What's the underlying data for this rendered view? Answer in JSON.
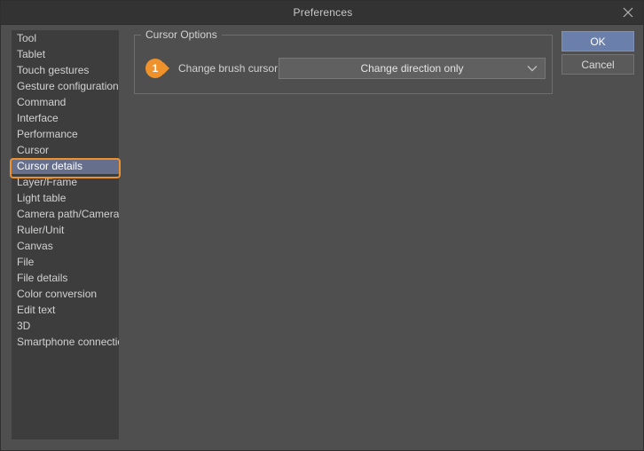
{
  "window": {
    "title": "Preferences",
    "close_icon": "close-icon"
  },
  "sidebar": {
    "items": [
      {
        "label": "Tool",
        "selected": false
      },
      {
        "label": "Tablet",
        "selected": false
      },
      {
        "label": "Touch gestures",
        "selected": false
      },
      {
        "label": "Gesture configuration",
        "selected": false
      },
      {
        "label": "Command",
        "selected": false
      },
      {
        "label": "Interface",
        "selected": false
      },
      {
        "label": "Performance",
        "selected": false
      },
      {
        "label": "Cursor",
        "selected": false
      },
      {
        "label": "Cursor details",
        "selected": true
      },
      {
        "label": "Layer/Frame",
        "selected": false
      },
      {
        "label": "Light table",
        "selected": false
      },
      {
        "label": "Camera path/Camera",
        "selected": false
      },
      {
        "label": "Ruler/Unit",
        "selected": false
      },
      {
        "label": "Canvas",
        "selected": false
      },
      {
        "label": "File",
        "selected": false
      },
      {
        "label": "File details",
        "selected": false
      },
      {
        "label": "Color conversion",
        "selected": false
      },
      {
        "label": "Edit text",
        "selected": false
      },
      {
        "label": "3D",
        "selected": false
      },
      {
        "label": "Smartphone connection",
        "selected": false
      }
    ]
  },
  "main": {
    "group_title": "Cursor Options",
    "badge": {
      "number": "1",
      "color": "#f0922b"
    },
    "field": {
      "label": "Change brush cursor:",
      "value": "Change direction only",
      "arrow_icon": "chevron-down-icon"
    }
  },
  "buttons": {
    "ok": "OK",
    "cancel": "Cancel"
  },
  "colors": {
    "accent_orange": "#f0922b",
    "selection_blue": "#66708c",
    "ok_button_blue": "#6b7fab",
    "dialog_background": "#4f4f4f",
    "sidebar_background": "#3d3d3d",
    "titlebar_background": "#333333"
  }
}
